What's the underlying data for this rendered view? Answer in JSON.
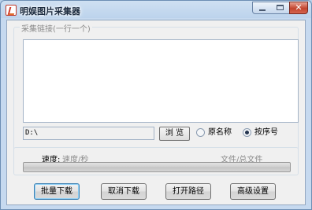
{
  "window": {
    "title": "明娱图片采集器",
    "close_glyph": "✕"
  },
  "links_group": {
    "legend": "采集链接(一行一个)",
    "links_text": ""
  },
  "save": {
    "path_value": "D:\\",
    "browse_label": "浏 览"
  },
  "naming": {
    "options": [
      {
        "label": "原名称",
        "checked": false
      },
      {
        "label": "按序号",
        "checked": true
      }
    ]
  },
  "status": {
    "speed_label": "速度:",
    "speed_value": "速度/秒",
    "files_value": "文件/总文件",
    "progress": 0
  },
  "actions": {
    "batch_download": "批量下载",
    "cancel_download": "取消下载",
    "open_path": "打开路径",
    "advanced_settings": "高级设置"
  },
  "colors": {
    "titlebar": "#bcd3ec",
    "client_bg": "#f0f0f0",
    "close_button": "#c3452f",
    "progress_fill": "#3cb34a"
  }
}
